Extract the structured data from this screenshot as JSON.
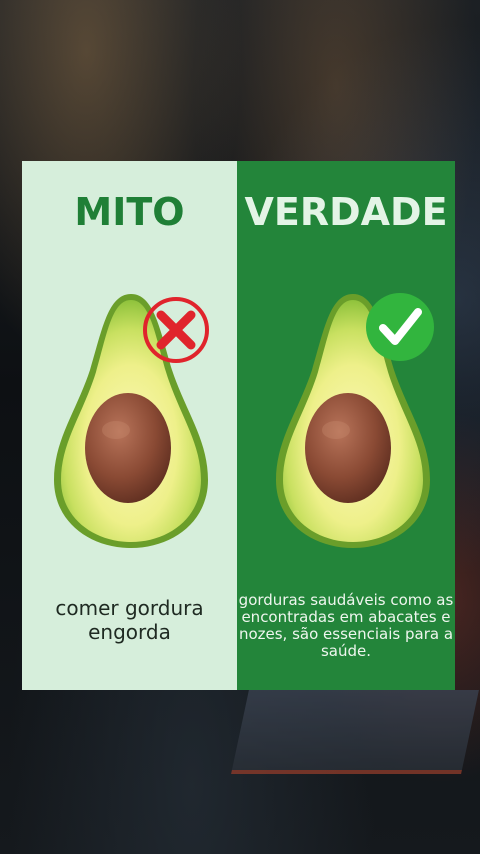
{
  "myth": {
    "title": "MITO",
    "caption": "comer gordura engorda",
    "badge_icon": "x-mark-icon",
    "color": "#1f7f36"
  },
  "truth": {
    "title": "VERDADE",
    "caption": "gorduras saudáveis como as encontradas em abacates e nozes, são essenciais para a saúde.",
    "badge_icon": "check-mark-icon",
    "color": "#23853a"
  }
}
